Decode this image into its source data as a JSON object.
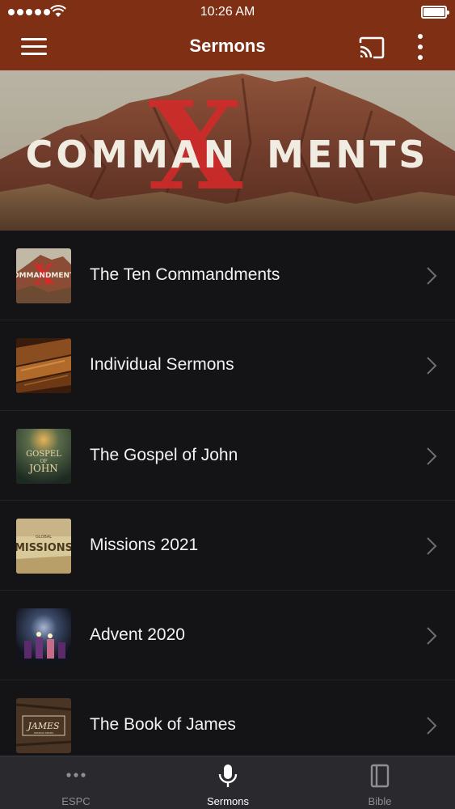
{
  "status": {
    "time": "10:26 AM"
  },
  "app_bar": {
    "title": "Sermons",
    "menu_icon": "hamburger-menu-icon",
    "cast_icon": "cast-icon",
    "more_icon": "more-vertical-icon",
    "color": "#7f2f13"
  },
  "hero": {
    "text_before": "COMMAN",
    "text_after": "MENTS",
    "overlay_letter": "X",
    "accent": "#d42a2a"
  },
  "series": [
    {
      "label": "The Ten Commandments",
      "thumb_text": "COMMANDMENTS",
      "thumb_overlay": "X"
    },
    {
      "label": "Individual Sermons"
    },
    {
      "label": "The Gospel of John",
      "thumb_line1": "GOSPEL",
      "thumb_line2": "OF",
      "thumb_line3": "JOHN"
    },
    {
      "label": "Missions 2021",
      "thumb_small": "GLOBAL",
      "thumb_text": "MISSIONS"
    },
    {
      "label": "Advent 2020"
    },
    {
      "label": "The Book of James",
      "thumb_text": "JAMES",
      "thumb_sub": "SERMON SERIES"
    }
  ],
  "tabs": [
    {
      "label": "ESPC",
      "icon": "more-dots-icon",
      "active": false
    },
    {
      "label": "Sermons",
      "icon": "microphone-icon",
      "active": true
    },
    {
      "label": "Bible",
      "icon": "book-icon",
      "active": false
    }
  ],
  "colors": {
    "active_tab": "#ffffff",
    "inactive_tab": "#8e8e93",
    "list_bg": "#141416"
  }
}
